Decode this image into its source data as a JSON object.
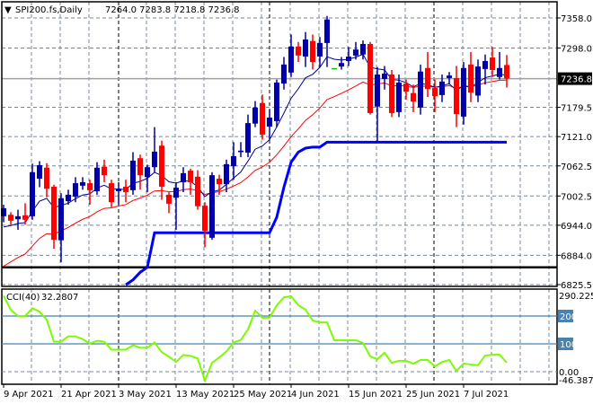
{
  "header": {
    "arrow": "▼",
    "symbol": "SPI200.fs,Daily",
    "ohlc": "7264.0 7283.8 7218.8 7236.8"
  },
  "cci_label": {
    "name": "CCI(40)",
    "value": "32.2807"
  },
  "colors": {
    "bull": "#0000aa",
    "bear": "#ff0000",
    "doji": "#00cc00",
    "fast_ma": "#00008b",
    "slow_ma": "#ff0000",
    "support": "#0000ff",
    "cci": "#7cfc00",
    "level": "#4682b4"
  },
  "chart_data": {
    "type": "candlestick",
    "price_ticks": [
      "7358.0",
      "7298.0",
      "7179.5",
      "7121.0",
      "7062.5",
      "7002.5",
      "6944.0",
      "6884.0",
      "6825.5"
    ],
    "current_price": "7236.8",
    "horizontal_level": 6860,
    "cci_ticks": {
      "max": "290.2255",
      "zero": "0.00",
      "min": "-46.3873",
      "levels": [
        "200",
        "100"
      ]
    },
    "date_labels": [
      {
        "i": 0,
        "label": "9 Apr 2021"
      },
      {
        "i": 8,
        "label": "21 Apr 2021"
      },
      {
        "i": 16,
        "label": "3 May 2021"
      },
      {
        "i": 24,
        "label": "13 May 2021"
      },
      {
        "i": 32,
        "label": "25 May 2021"
      },
      {
        "i": 40,
        "label": "4 Jun 2021"
      },
      {
        "i": 48,
        "label": "15 Jun 2021"
      },
      {
        "i": 56,
        "label": "25 Jun 2021"
      },
      {
        "i": 64,
        "label": "7 Jul 2021"
      }
    ],
    "ohlc": [
      [
        6962,
        6985,
        6950,
        6978
      ],
      [
        6965,
        6970,
        6945,
        6953
      ],
      [
        6956,
        6975,
        6935,
        6962
      ],
      [
        6964,
        6988,
        6945,
        6955
      ],
      [
        6962,
        7067,
        6955,
        7050
      ],
      [
        7037,
        7072,
        7020,
        7064
      ],
      [
        7059,
        7068,
        7000,
        7017
      ],
      [
        7021,
        7025,
        6897,
        6915
      ],
      [
        6914,
        7008,
        6870,
        6998
      ],
      [
        6992,
        7015,
        6985,
        7005
      ],
      [
        7001,
        7040,
        6990,
        7028
      ],
      [
        7023,
        7040,
        7015,
        7030
      ],
      [
        7028,
        7035,
        6985,
        7014
      ],
      [
        7012,
        7070,
        7005,
        7059
      ],
      [
        7061,
        7075,
        7030,
        7044
      ],
      [
        7028,
        7035,
        6980,
        6990
      ],
      [
        7012,
        7030,
        6985,
        7017
      ],
      [
        7021,
        7035,
        6990,
        7010
      ],
      [
        7014,
        7090,
        7005,
        7073
      ],
      [
        7078,
        7085,
        7015,
        7044
      ],
      [
        7040,
        7065,
        7010,
        7060
      ],
      [
        7060,
        7140,
        7050,
        7091
      ],
      [
        7103,
        7113,
        6995,
        7021
      ],
      [
        7005,
        7010,
        6968,
        6987
      ],
      [
        6999,
        7030,
        6935,
        7019
      ],
      [
        7030,
        7060,
        7010,
        7048
      ],
      [
        7053,
        7057,
        7005,
        7030
      ],
      [
        7041,
        7054,
        6975,
        6982
      ],
      [
        6983,
        6990,
        6900,
        6933
      ],
      [
        6919,
        7050,
        6915,
        7044
      ],
      [
        7037,
        7045,
        7005,
        7026
      ],
      [
        7026,
        7075,
        7010,
        7066
      ],
      [
        7062,
        7110,
        7035,
        7082
      ],
      [
        7090,
        7110,
        7080,
        7093
      ],
      [
        7089,
        7165,
        7080,
        7148
      ],
      [
        7147,
        7192,
        7140,
        7179
      ],
      [
        7188,
        7205,
        7115,
        7125
      ],
      [
        7141,
        7175,
        7115,
        7159
      ],
      [
        7152,
        7235,
        7140,
        7229
      ],
      [
        7227,
        7280,
        7215,
        7265
      ],
      [
        7249,
        7325,
        7240,
        7301
      ],
      [
        7301,
        7310,
        7270,
        7283
      ],
      [
        7281,
        7330,
        7260,
        7315
      ],
      [
        7312,
        7325,
        7255,
        7270
      ],
      [
        7281,
        7320,
        7260,
        7308
      ],
      [
        7308,
        7362,
        7260,
        7355
      ],
      [
        7258,
        7258,
        7258,
        7258
      ],
      [
        7261,
        7280,
        7255,
        7268
      ],
      [
        7272,
        7300,
        7262,
        7281
      ],
      [
        7283,
        7310,
        7275,
        7295
      ],
      [
        7285,
        7313,
        7275,
        7306
      ],
      [
        7306,
        7310,
        7165,
        7168
      ],
      [
        7181,
        7260,
        7112,
        7245
      ],
      [
        7236,
        7262,
        7215,
        7247
      ],
      [
        7245,
        7254,
        7160,
        7168
      ],
      [
        7170,
        7245,
        7160,
        7229
      ],
      [
        7227,
        7235,
        7195,
        7211
      ],
      [
        7208,
        7225,
        7170,
        7191
      ],
      [
        7179,
        7265,
        7165,
        7251
      ],
      [
        7258,
        7290,
        7200,
        7216
      ],
      [
        7218,
        7235,
        7170,
        7202
      ],
      [
        7204,
        7245,
        7190,
        7231
      ],
      [
        7238,
        7250,
        7225,
        7243
      ],
      [
        7238,
        7262,
        7140,
        7166
      ],
      [
        7161,
        7270,
        7145,
        7258
      ],
      [
        7265,
        7290,
        7190,
        7209
      ],
      [
        7203,
        7275,
        7190,
        7261
      ],
      [
        7256,
        7285,
        7225,
        7272
      ],
      [
        7279,
        7300,
        7240,
        7254
      ],
      [
        7240,
        7290,
        7235,
        7258
      ],
      [
        7264,
        7284,
        7219,
        7237
      ]
    ],
    "support_line": {
      "start": 17,
      "values": [
        6825,
        6835,
        6850,
        6860,
        6929,
        6929,
        6929,
        6929,
        6929,
        6929,
        6929,
        6929,
        6929,
        6929,
        6929,
        6929,
        6929,
        6929,
        6929,
        6929,
        6929,
        6960,
        7020,
        7070,
        7090,
        7098,
        7100,
        7100,
        7110,
        7110,
        7110,
        7110,
        7110,
        7110,
        7110,
        7110,
        7110,
        7110,
        7110,
        7110,
        7110,
        7110,
        7110,
        7110,
        7110,
        7110,
        7110,
        7110,
        7110,
        7110,
        7110,
        7110,
        7110,
        7110
      ]
    },
    "cci": [
      273,
      222,
      200,
      200,
      228,
      216,
      187,
      108,
      108,
      127,
      127,
      117,
      101,
      111,
      108,
      79,
      79,
      79,
      95,
      86,
      86,
      105,
      70,
      54,
      35,
      60,
      57,
      48,
      -32,
      32,
      51,
      73,
      105,
      114,
      152,
      219,
      194,
      194,
      238,
      267,
      271,
      239,
      223,
      184,
      177,
      177,
      113,
      113,
      113,
      113,
      103,
      55,
      45,
      68,
      32,
      39,
      39,
      29,
      42,
      42,
      19,
      35,
      42,
      3,
      29,
      26,
      23,
      58,
      61,
      61,
      32.28
    ]
  }
}
